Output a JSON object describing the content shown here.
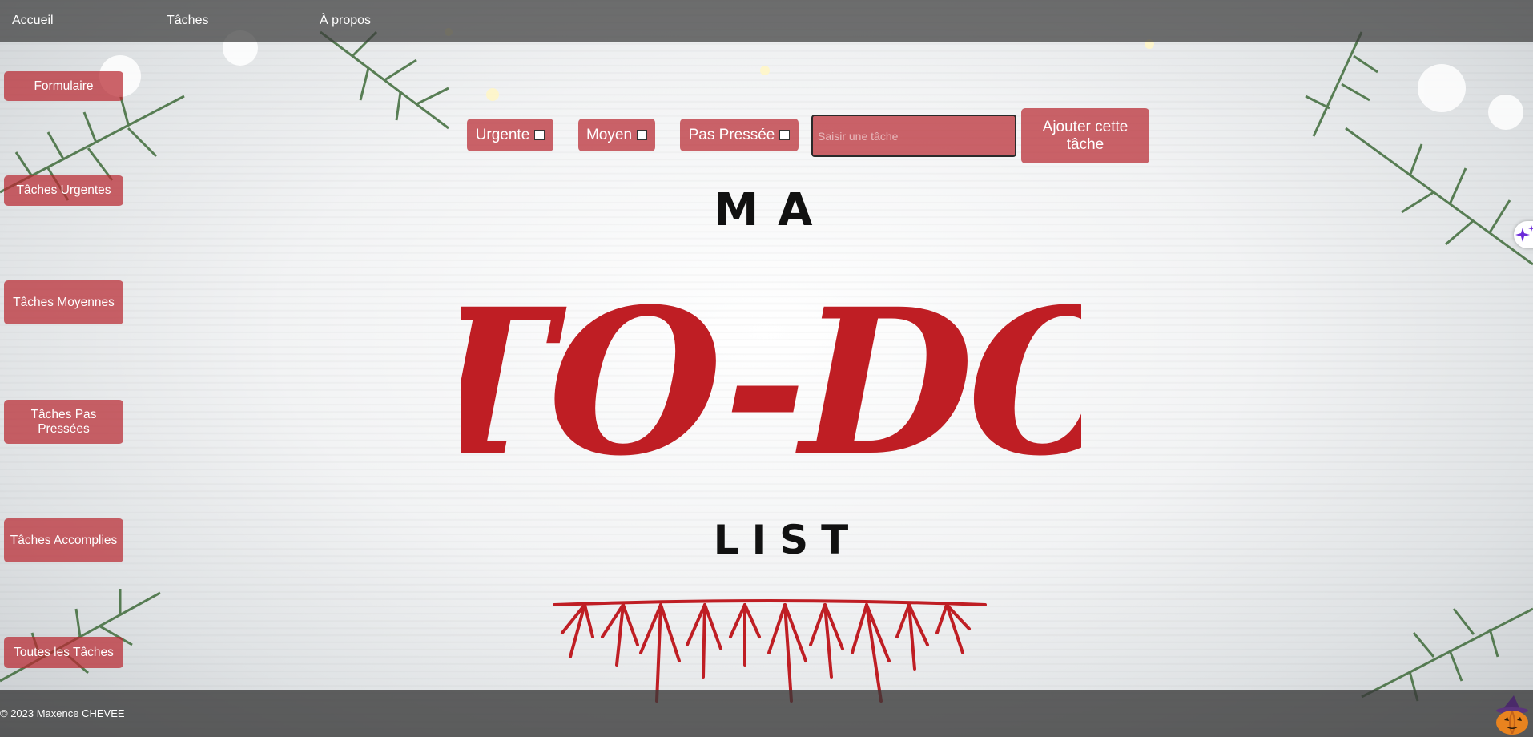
{
  "nav": {
    "items": [
      "Accueil",
      "Tâches",
      "À propos"
    ]
  },
  "sidebar": {
    "items": [
      {
        "label": "Formulaire"
      },
      {
        "label": "Tâches Urgentes"
      },
      {
        "label": "Tâches Moyennes"
      },
      {
        "label": "Tâches Pas Pressées"
      },
      {
        "label": "Tâches Accomplies"
      },
      {
        "label": "Toutes les Tâches"
      }
    ]
  },
  "form": {
    "priorities": [
      "Urgente",
      "Moyen",
      "Pas Pressée"
    ],
    "task_placeholder": "Saisir une tâche",
    "add_button": "Ajouter cette tâche"
  },
  "title": {
    "top": "MA",
    "main": "TO-DO",
    "bottom": "LIST"
  },
  "footer": {
    "copyright": "© 2023 Maxence CHEVEE"
  },
  "colors": {
    "accent": "#b9282f",
    "nav_bg": "#3c3c3c"
  },
  "icons": {
    "extension": "sparkle-icon",
    "corner": "pumpkin-icon"
  }
}
